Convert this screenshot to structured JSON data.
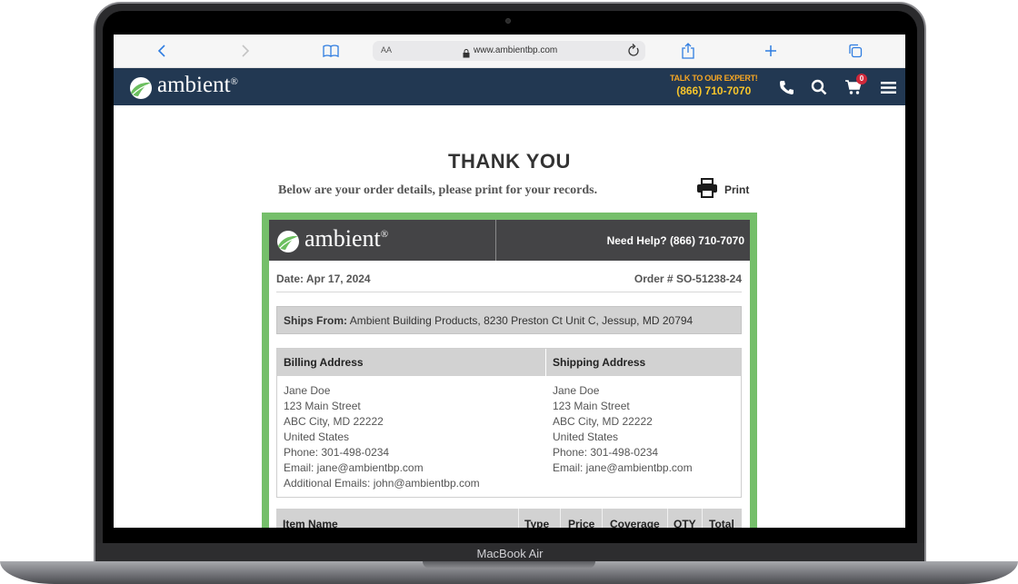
{
  "device": {
    "label": "MacBook Air"
  },
  "browser": {
    "text_size_label": "AA",
    "url": "www.ambientbp.com"
  },
  "site_header": {
    "logo_text": "ambient",
    "logo_mark": "®",
    "expert_label": "TALK TO OUR EXPERT!",
    "expert_phone": "(866) 710-7070",
    "cart_count": "0",
    "colors": {
      "background": "#223852",
      "accent": "#f6a623"
    }
  },
  "page": {
    "title": "THANK YOU",
    "subtitle": "Below are your order details, please print for your records.",
    "print_label": "Print"
  },
  "order": {
    "logo_text": "ambient",
    "logo_mark": "®",
    "help_text": "Need Help? (866) 710-7070",
    "date": "Date: Apr 17, 2024",
    "order_number": "Order # SO-51238-24",
    "ships_from_label": "Ships From:",
    "ships_from_value": "Ambient Building Products, 8230 Preston Ct Unit C, Jessup, MD 20794",
    "billing": {
      "title": "Billing Address",
      "lines": [
        "Jane Doe",
        "123 Main Street",
        "ABC City, MD 22222",
        "United States",
        "Phone: 301-498-0234",
        "Email: jane@ambientbp.com",
        "Additional Emails: john@ambientbp.com"
      ]
    },
    "shipping": {
      "title": "Shipping Address",
      "lines": [
        "Jane Doe",
        "123 Main Street",
        "ABC City, MD 22222",
        "United States",
        "Phone: 301-498-0234",
        "Email: jane@ambientbp.com"
      ]
    },
    "item_columns": [
      "Item Name",
      "Type",
      "Price",
      "Coverage",
      "QTY",
      "Total"
    ],
    "colors": {
      "card_border": "#75bf6a",
      "card_header": "#444446"
    }
  }
}
